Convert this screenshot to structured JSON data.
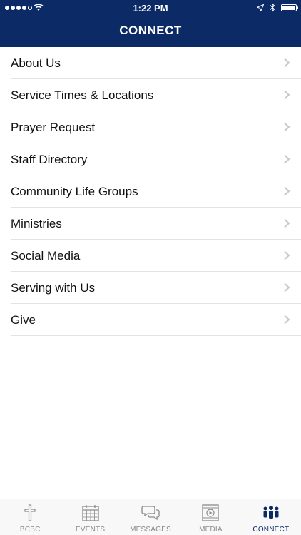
{
  "status_bar": {
    "time": "1:22 PM"
  },
  "header": {
    "title": "CONNECT"
  },
  "menu": {
    "items": [
      {
        "label": "About Us"
      },
      {
        "label": "Service Times & Locations"
      },
      {
        "label": "Prayer Request"
      },
      {
        "label": "Staff Directory"
      },
      {
        "label": "Community Life Groups"
      },
      {
        "label": "Ministries"
      },
      {
        "label": "Social Media"
      },
      {
        "label": "Serving with Us"
      },
      {
        "label": "Give"
      }
    ]
  },
  "tab_bar": {
    "tabs": [
      {
        "label": "BCBC",
        "icon": "cross-icon"
      },
      {
        "label": "EVENTS",
        "icon": "calendar-icon"
      },
      {
        "label": "MESSAGES",
        "icon": "chat-bubbles-icon"
      },
      {
        "label": "MEDIA",
        "icon": "film-play-icon"
      },
      {
        "label": "CONNECT",
        "icon": "people-icon"
      }
    ],
    "active": "CONNECT"
  },
  "colors": {
    "header_bg": "#0b2a66",
    "active_tab": "#0b2a66",
    "inactive_tab": "#8a8a8a",
    "chevron": "#c7c7cc",
    "divider": "#e3e3e3"
  }
}
